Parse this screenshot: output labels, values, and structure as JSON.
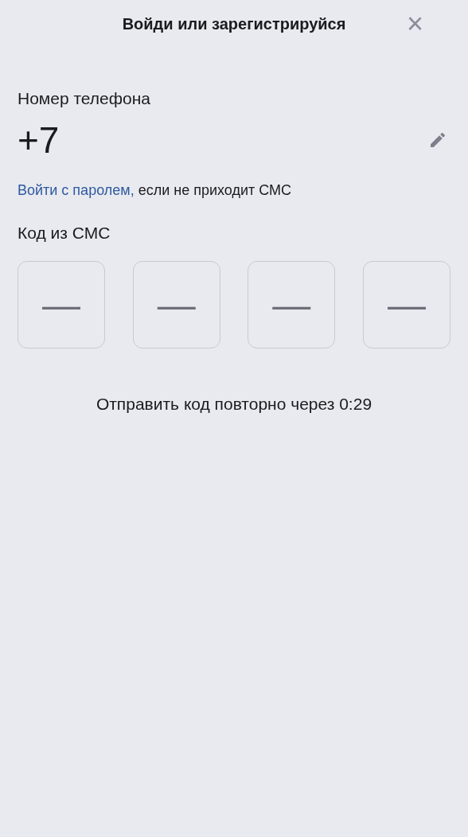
{
  "header": {
    "title": "Войди или зарегистрируйся",
    "close": "×"
  },
  "phone": {
    "label": "Номер телефона",
    "value": "+7"
  },
  "password_hint": {
    "link": "Войти с паролем,",
    "text": "если не приходит СМС"
  },
  "sms_code": {
    "label": "Код из СМС",
    "fields": [
      {
        "placeholder": "—"
      },
      {
        "placeholder": "—"
      },
      {
        "placeholder": "—"
      },
      {
        "placeholder": "—"
      }
    ]
  },
  "resend": "Отправить код повторно через 0:29"
}
